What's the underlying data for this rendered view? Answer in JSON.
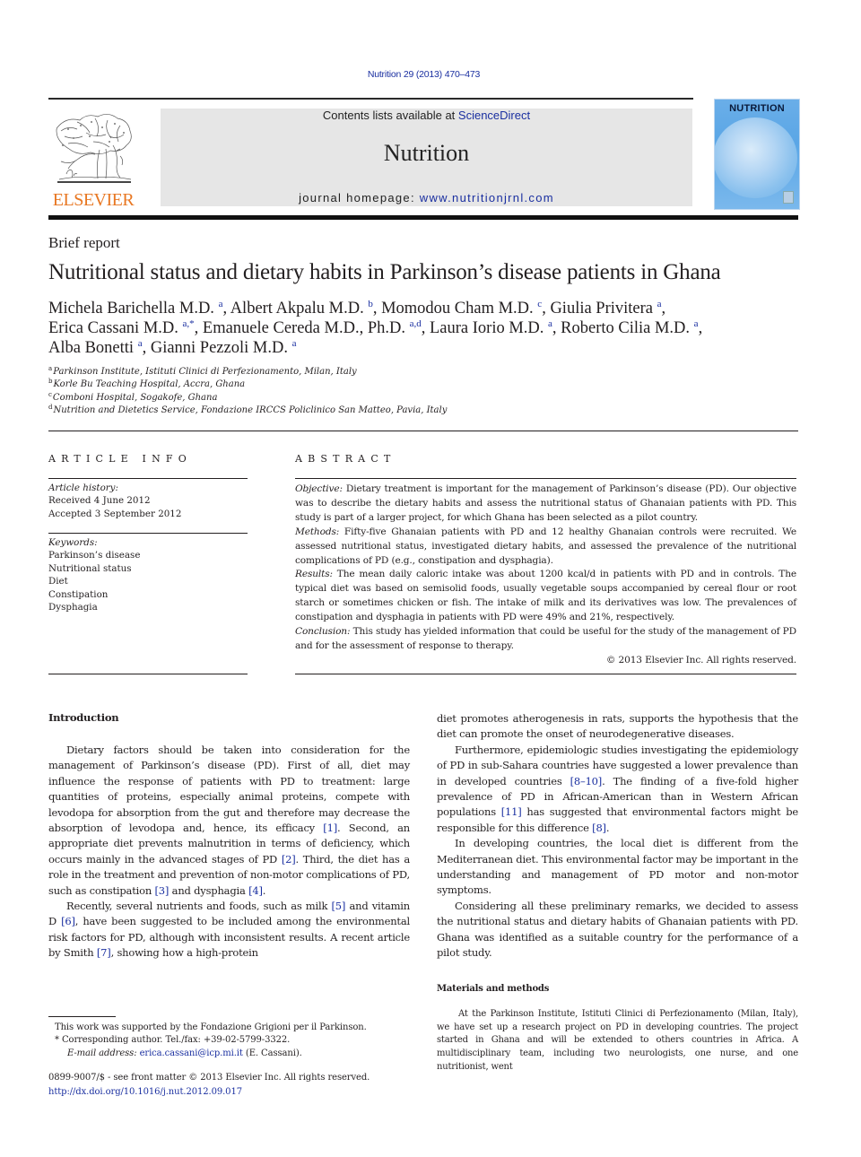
{
  "header": {
    "citation": "Nutrition 29 (2013) 470–473",
    "contents_prefix": "Contents lists available at ",
    "contents_link": "ScienceDirect",
    "journal_name": "Nutrition",
    "homepage_prefix": "journal homepage: ",
    "homepage_link": "www.nutritionjrnl.com",
    "publisher_logo_text": "ELSEVIER",
    "cover_title": "NUTRITION",
    "colors": {
      "elsevier_orange": "#e87722",
      "link_blue": "#1a2fa0",
      "header_box_gray": "#e6e6e6",
      "cover_blue": "#5aa6e6"
    }
  },
  "article": {
    "type": "Brief report",
    "title": "Nutritional status and dietary habits in Parkinson’s disease patients in Ghana",
    "authors": [
      {
        "name": "Michela Barichella M.D.",
        "aff": "a",
        "sep": ", "
      },
      {
        "name": "Albert Akpalu M.D.",
        "aff": "b",
        "sep": ", "
      },
      {
        "name": "Momodou Cham M.D.",
        "aff": "c",
        "sep": ", "
      },
      {
        "name": "Giulia Privitera",
        "aff": "a",
        "sep": ",",
        "break": true
      },
      {
        "name": "Erica Cassani M.D.",
        "aff": "a,*",
        "sep": ", "
      },
      {
        "name": "Emanuele Cereda M.D., Ph.D.",
        "aff": "a,d",
        "sep": ", "
      },
      {
        "name": "Laura Iorio M.D.",
        "aff": "a",
        "sep": ", "
      },
      {
        "name": "Roberto Cilia M.D.",
        "aff": "a",
        "sep": ",",
        "break": true
      },
      {
        "name": "Alba Bonetti",
        "aff": "a",
        "sep": ", "
      },
      {
        "name": "Gianni Pezzoli M.D.",
        "aff": "a",
        "sep": ""
      }
    ],
    "affiliations": [
      {
        "key": "a",
        "text": "Parkinson Institute, Istituti Clinici di Perfezionamento, Milan, Italy"
      },
      {
        "key": "b",
        "text": "Korle Bu Teaching Hospital, Accra, Ghana"
      },
      {
        "key": "c",
        "text": "Comboni Hospital, Sogakofe, Ghana"
      },
      {
        "key": "d",
        "text": "Nutrition and Dietetics Service, Fondazione IRCCS Policlinico San Matteo, Pavia, Italy"
      }
    ]
  },
  "article_info": {
    "heading": "ARTICLE INFO",
    "history_label": "Article history:",
    "received": "Received 4 June 2012",
    "accepted": "Accepted 3 September 2012",
    "keywords_label": "Keywords:",
    "keywords": [
      "Parkinson’s disease",
      "Nutritional status",
      "Diet",
      "Constipation",
      "Dysphagia"
    ]
  },
  "abstract": {
    "heading": "ABSTRACT",
    "objective_label": "Objective:",
    "objective": " Dietary treatment is important for the management of Parkinson’s disease (PD). Our objective was to describe the dietary habits and assess the nutritional status of Ghanaian patients with PD. This study is part of a larger project, for which Ghana has been selected as a pilot country.",
    "methods_label": "Methods:",
    "methods": " Fifty-five Ghanaian patients with PD and 12 healthy Ghanaian controls were recruited. We assessed nutritional status, investigated dietary habits, and assessed the prevalence of the nutritional complications of PD (e.g., constipation and dysphagia).",
    "results_label": "Results:",
    "results": " The mean daily caloric intake was about 1200 kcal/d in patients with PD and in controls. The typical diet was based on semisolid foods, usually vegetable soups accompanied by cereal flour or root starch or sometimes chicken or fish. The intake of milk and its derivatives was low. The prevalences of constipation and dysphagia in patients with PD were 49% and 21%, respectively.",
    "conclusion_label": "Conclusion:",
    "conclusion": " This study has yielded information that could be useful for the study of the management of PD and for the assessment of response to therapy.",
    "copyright": "© 2013 Elsevier Inc. All rights reserved."
  },
  "introduction": {
    "heading": "Introduction",
    "p1": [
      {
        "t": "Dietary factors should be taken into consideration for the management of Parkinson’s disease (PD). First of all, diet may influence the response of patients with PD to treatment: large quantities of proteins, especially animal proteins, compete with levodopa for absorption from the gut and therefore may decrease the absorption of levodopa and, hence, its efficacy "
      },
      {
        "ref": "[1]"
      },
      {
        "t": ". Second, an appropriate diet prevents malnutrition in terms of deficiency, which occurs mainly in the advanced stages of PD "
      },
      {
        "ref": "[2]"
      },
      {
        "t": ". Third, the diet has a role in the treatment and prevention of non-motor complications of PD, such as constipation "
      },
      {
        "ref": "[3]"
      },
      {
        "t": " and dysphagia "
      },
      {
        "ref": "[4]"
      },
      {
        "t": "."
      }
    ],
    "p2": [
      {
        "t": "Recently, several nutrients and foods, such as milk "
      },
      {
        "ref": "[5]"
      },
      {
        "t": " and vitamin D "
      },
      {
        "ref": "[6]"
      },
      {
        "t": ", have been suggested to be included among the environmental risk factors for PD, although with inconsistent results. A recent article by Smith "
      },
      {
        "ref": "[7]"
      },
      {
        "t": ", showing how a high-protein diet promotes atherogenesis in rats, supports the hypothesis that the diet can promote the onset of neurodegenerative diseases."
      }
    ],
    "p3": [
      {
        "t": "Furthermore, epidemiologic studies investigating the epidemiology of PD in sub-Sahara countries have suggested a lower prevalence than in developed countries "
      },
      {
        "ref": "[8–10]"
      },
      {
        "t": ". The finding of a five-fold higher prevalence of PD in African-American than in Western African populations "
      },
      {
        "ref": "[11]"
      },
      {
        "t": " has suggested that environmental factors might be responsible for this difference "
      },
      {
        "ref": "[8]"
      },
      {
        "t": "."
      }
    ],
    "p4": [
      {
        "t": "In developing countries, the local diet is different from the Mediterranean diet. This environmental factor may be important in the understanding and management of PD motor and non-motor symptoms."
      }
    ],
    "p5": [
      {
        "t": "Considering all these preliminary remarks, we decided to assess the nutritional status and dietary habits of Ghanaian patients with PD. Ghana was identified as a suitable country for the performance of a pilot study."
      }
    ]
  },
  "methods": {
    "heading": "Materials and methods",
    "p1": "At the Parkinson Institute, Istituti Clinici di Perfezionamento (Milan, Italy), we have set up a research project on PD in developing countries. The project started in Ghana and will be extended to others countries in Africa. A multidisciplinary team, including two neurologists, one nurse, and one nutritionist, went"
  },
  "footnotes": {
    "funding": "This work was supported by the Fondazione Grigioni per il Parkinson.",
    "corresponding": "* Corresponding author. Tel./fax: +39-02-5799-3322.",
    "email_label": "E-mail address:",
    "email": "erica.cassani@icp.mi.it",
    "email_suffix": " (E. Cassani).",
    "issn": "0899-9007/$ - see front matter © 2013 Elsevier Inc. All rights reserved.",
    "doi": "http://dx.doi.org/10.1016/j.nut.2012.09.017"
  }
}
